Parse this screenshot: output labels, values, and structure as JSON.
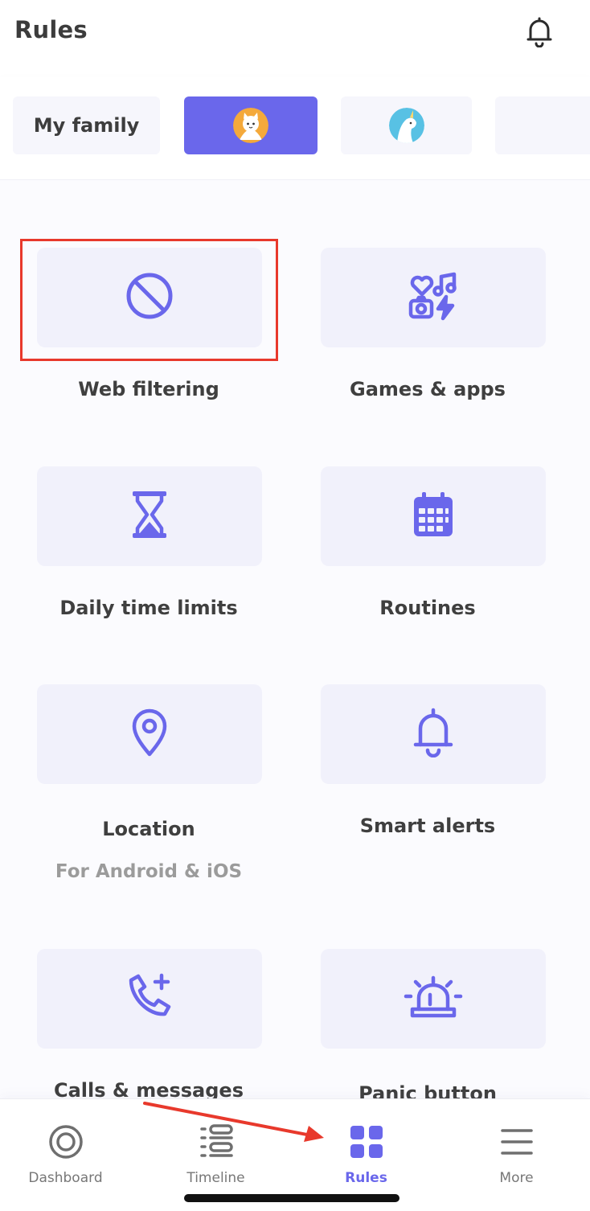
{
  "header": {
    "title": "Rules"
  },
  "profiles": {
    "my_family_label": "My family"
  },
  "cards": [
    {
      "label": "Web filtering",
      "icon": "block-icon"
    },
    {
      "label": "Games & apps",
      "icon": "apps-icon"
    },
    {
      "label": "Daily time limits",
      "icon": "hourglass-icon"
    },
    {
      "label": "Routines",
      "icon": "calendar-icon"
    },
    {
      "label": "Location",
      "sub": "For Android & iOS",
      "icon": "location-pin-icon"
    },
    {
      "label": "Smart alerts",
      "icon": "bell-icon"
    },
    {
      "label": "Calls & messages",
      "icon": "phone-plus-icon"
    },
    {
      "label": "Panic button",
      "icon": "siren-icon"
    }
  ],
  "tabbar": {
    "tabs": [
      {
        "label": "Dashboard",
        "icon": "dashboard-icon"
      },
      {
        "label": "Timeline",
        "icon": "timeline-icon"
      },
      {
        "label": "Rules",
        "icon": "grid-icon",
        "active": true
      },
      {
        "label": "More",
        "icon": "menu-icon"
      }
    ]
  },
  "colors": {
    "accent": "#6a67eb",
    "tile": "#f1f1fb",
    "annotation": "#e8392c"
  }
}
